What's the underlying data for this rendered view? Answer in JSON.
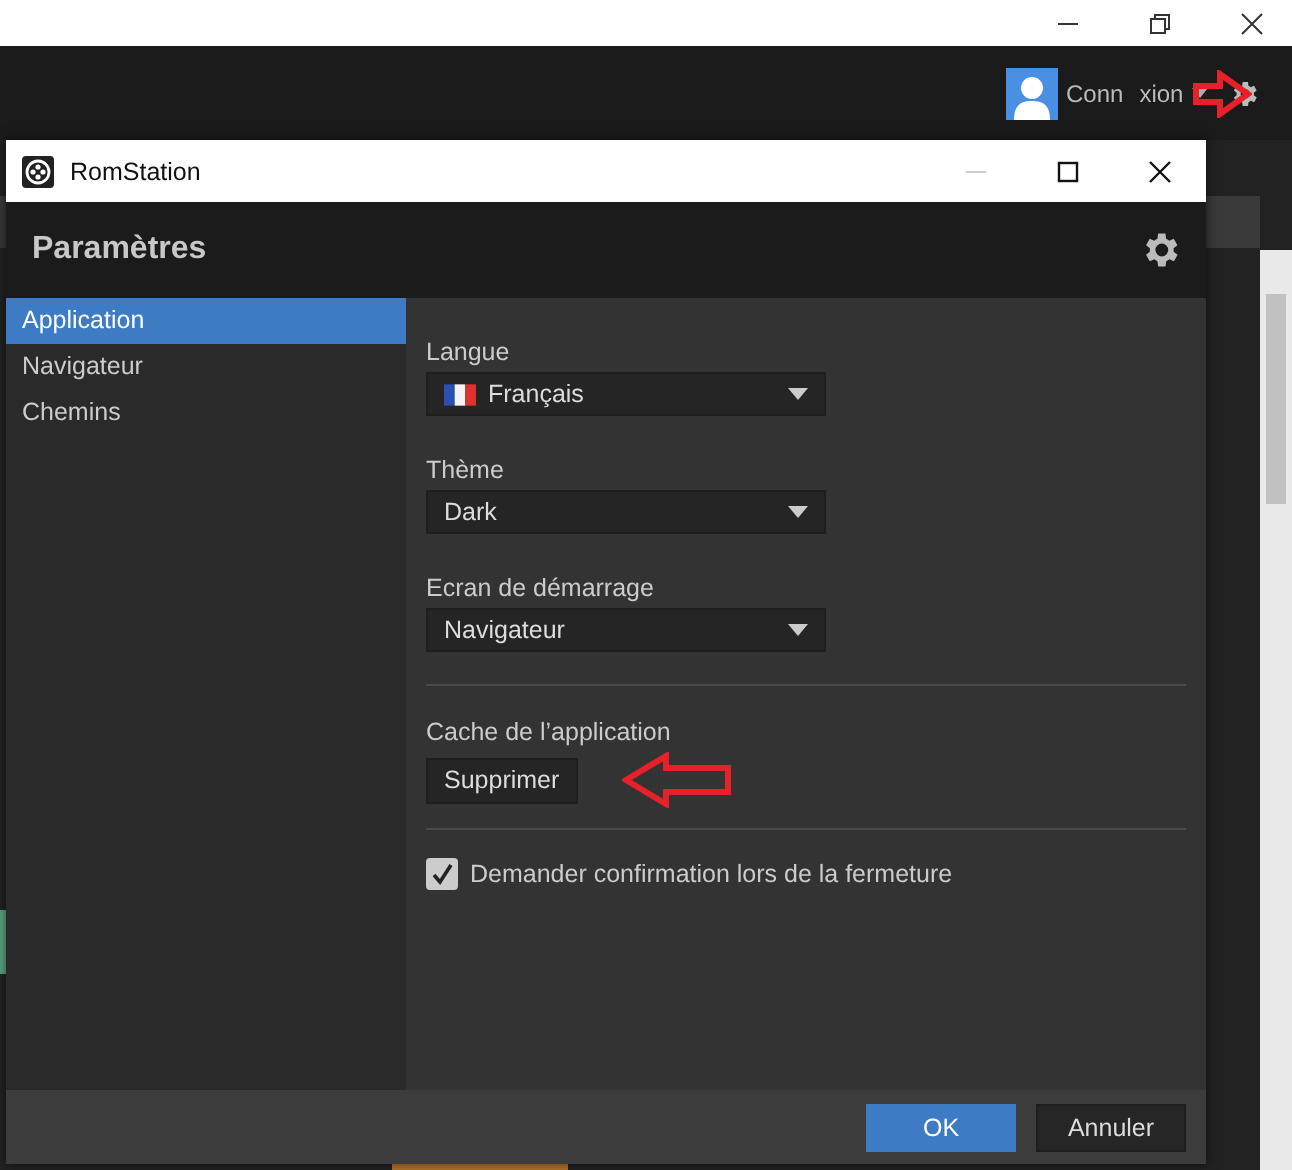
{
  "background_app": {
    "account": {
      "label_before": "Conn",
      "label_after": "xion"
    }
  },
  "window": {
    "title": "RomStation"
  },
  "header": {
    "title": "Paramètres"
  },
  "sidebar": {
    "items": [
      {
        "label": "Application",
        "selected": true
      },
      {
        "label": "Navigateur",
        "selected": false
      },
      {
        "label": "Chemins",
        "selected": false
      }
    ]
  },
  "settings": {
    "selects": [
      {
        "label": "Langue",
        "value": "Français",
        "kind": "flag"
      },
      {
        "label": "Thème",
        "value": "Dark",
        "kind": "plain"
      },
      {
        "label": "Ecran de démarrage",
        "value": "Navigateur",
        "kind": "plain"
      }
    ],
    "cache": {
      "label": "Cache de l’application",
      "button": "Supprimer"
    },
    "confirm": {
      "label": "Demander confirmation lors de la fermeture",
      "checked": true
    }
  },
  "buttons": {
    "ok": "OK",
    "cancel": "Annuler"
  }
}
